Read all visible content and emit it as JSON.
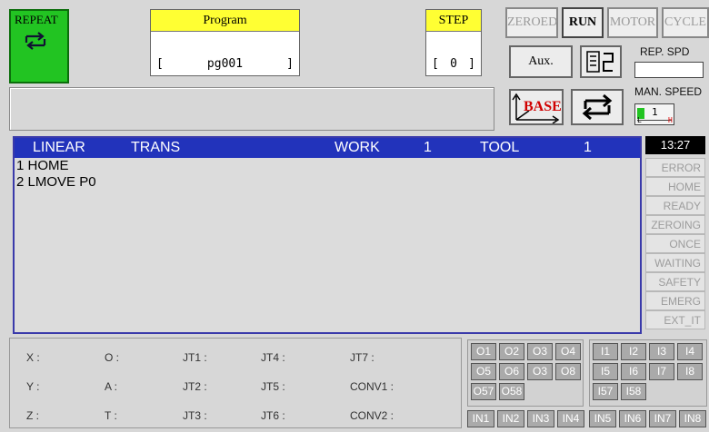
{
  "repeat": {
    "label": "REPEAT"
  },
  "program": {
    "header": "Program",
    "bracket_open": "[",
    "name": "pg001",
    "bracket_close": "]"
  },
  "step": {
    "header": "STEP",
    "bracket_open": "[",
    "value": "0",
    "bracket_close": "]"
  },
  "modes": {
    "zeroed": "ZEROED",
    "run": "RUN",
    "motor": "MOTOR",
    "cycle": "CYCLE"
  },
  "aux": {
    "label": "Aux."
  },
  "base": {
    "label": "BASE"
  },
  "rep_spd": {
    "label": "REP. SPD"
  },
  "man_speed": {
    "label": "MAN. SPEED",
    "value": "1",
    "low": "L",
    "high": "H"
  },
  "listing": {
    "header": {
      "interp": "LINEAR",
      "coord": "TRANS",
      "work_label": "WORK",
      "work_value": "1",
      "tool_label": "TOOL",
      "tool_value": "1"
    },
    "lines": [
      "1 HOME",
      "2 LMOVE P0"
    ]
  },
  "time": "13:27",
  "status_items": [
    "ERROR",
    "HOME",
    "READY",
    "ZEROING",
    "ONCE",
    "WAITING",
    "SAFETY",
    "EMERG",
    "EXT_IT"
  ],
  "coords": {
    "row1": [
      "X :",
      "O :",
      "JT1 :",
      "JT4 :",
      "JT7 :"
    ],
    "row2": [
      "Y :",
      "A :",
      "JT2 :",
      "JT5 :",
      "CONV1 :"
    ],
    "row3": [
      "Z :",
      "T :",
      "JT3 :",
      "JT6 :",
      "CONV2 :"
    ]
  },
  "outputs": [
    "O1",
    "O2",
    "O3",
    "O4",
    "O5",
    "O6",
    "O3",
    "O8",
    "O57",
    "O58"
  ],
  "inputs": [
    "I1",
    "I2",
    "I3",
    "I4",
    "I5",
    "I6",
    "I7",
    "I8",
    "I57",
    "I58"
  ],
  "in_buttons": [
    "IN1",
    "IN2",
    "IN3",
    "IN4",
    "IN5",
    "IN6",
    "IN7",
    "IN8"
  ]
}
